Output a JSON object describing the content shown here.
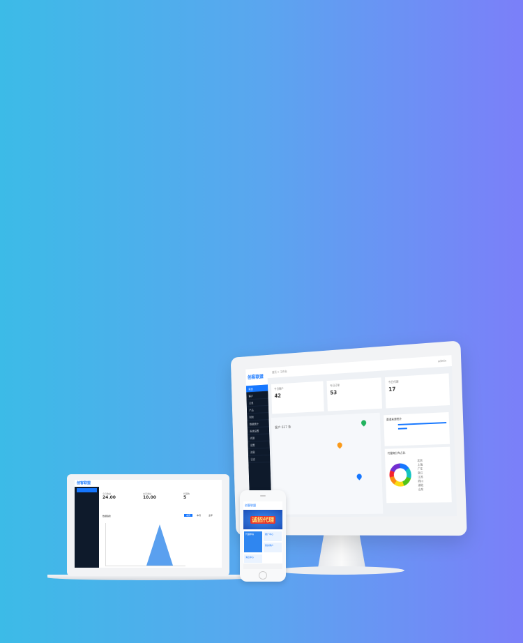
{
  "monitor": {
    "logo": "创客联盟",
    "breadcrumb": [
      "首页",
      "工作台"
    ],
    "sidebar": [
      "首页",
      "客户",
      "订单",
      "产品",
      "财务",
      "数据统计",
      "系统设置",
      "代理",
      "设置",
      "消息",
      "日志"
    ],
    "cards": [
      {
        "title": "今日客户",
        "value": "42"
      },
      {
        "title": "今日订单",
        "value": "53"
      },
      {
        "title": "今日代理",
        "value": "17"
      }
    ],
    "map_caption": "客户 617 条",
    "panel_title": "渠道来源统计",
    "ring_title": "代理商分布占比",
    "legend": [
      "北京",
      "上海",
      "广东",
      "浙江",
      "江苏",
      "四川",
      "湖北",
      "山东"
    ],
    "user": "admin"
  },
  "laptop": {
    "logo": "创客联盟",
    "cards": [
      {
        "title": "今日收益",
        "value": "24.00"
      },
      {
        "title": "本月收益",
        "value": "10.00"
      },
      {
        "title": "代理数",
        "value": "5"
      }
    ],
    "chart_title": "数据趋势",
    "tabs": [
      "本周",
      "本月",
      "全年"
    ]
  },
  "phone": {
    "logo": "创客联盟",
    "banner": "诚招代理",
    "tiles": [
      "代理申请",
      "推广中心",
      "我的客户",
      "消息中心"
    ]
  },
  "colors": {
    "accent": "#1677ff",
    "sidebar": "#0e1a2b",
    "bg_left": "#3cbbe7",
    "bg_right": "#7b7ff9"
  }
}
